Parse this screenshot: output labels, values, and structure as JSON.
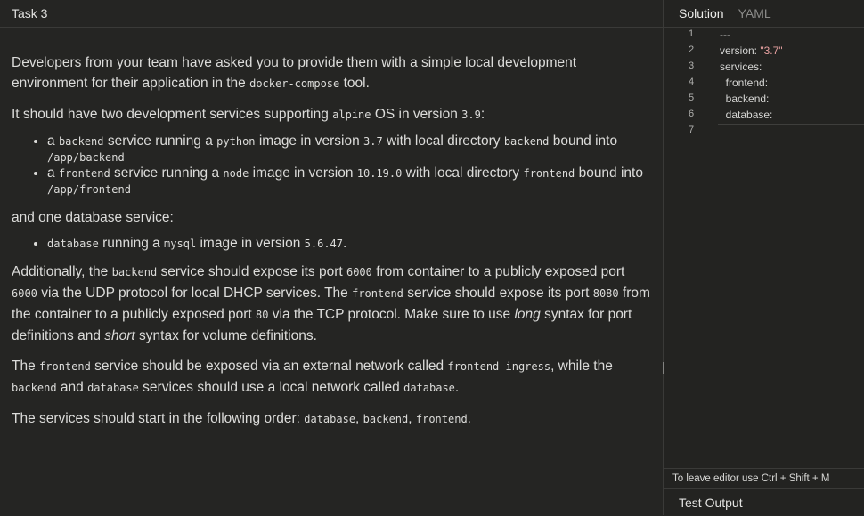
{
  "task": {
    "title": "Task 3",
    "p1_a": "Developers from your team have asked you to provide them with a simple local development environment for their application in the ",
    "p1_code": "docker-compose",
    "p1_b": " tool.",
    "p2_a": "It should have two development services supporting ",
    "p2_code1": "alpine",
    "p2_b": " OS in version ",
    "p2_code2": "3.9",
    "p2_c": ":",
    "bullet1": {
      "code1": "backend",
      "t1": " service running a ",
      "code2": "python",
      "t2": " image in version ",
      "code3": "3.7",
      "t3": " with local directory ",
      "code4": "backend",
      "t4": " bound into ",
      "code5": "/app/backend"
    },
    "bullet2": {
      "code1": "frontend",
      "t1": " service running a ",
      "code2": "node",
      "t2": " image in version ",
      "code3": "10.19.0",
      "t3": " with local directory ",
      "code4": "frontend",
      "t4": " bound into ",
      "code5": "/app/frontend"
    },
    "p3": "and one database service:",
    "bullet3": {
      "code1": "database",
      "t1": " running a ",
      "code2": "mysql",
      "t2": " image in version ",
      "code3": "5.6.47",
      "t3": "."
    },
    "p4": {
      "a": "Additionally, the ",
      "c1": "backend",
      "b": " service should expose its port ",
      "c2": "6000",
      "c": " from container to a publicly exposed port ",
      "c3": "6000",
      "d": " via the UDP protocol for local DHCP services. The ",
      "c4": "frontend",
      "e": " service should expose its port ",
      "c5": "8080",
      "f": " from the container to a publicly exposed port ",
      "c6": "80",
      "g": " via the TCP protocol. Make sure to use ",
      "em1": "long",
      "h": " syntax for port definitions and ",
      "em2": "short",
      "i": " syntax for volume definitions."
    },
    "p5": {
      "a": "The ",
      "c1": "frontend",
      "b": " service should be exposed via an external network called ",
      "c2": "frontend-ingress",
      "c": ", while the ",
      "c3": "backend",
      "d": " and ",
      "c4": "database",
      "e": " services should use a local network called ",
      "c5": "database",
      "f": "."
    },
    "p6": {
      "a": "The services should start in the following order: ",
      "c1": "database",
      "b": ", ",
      "c2": "backend",
      "c": ", ",
      "c3": "frontend",
      "d": "."
    }
  },
  "editor": {
    "tabs": [
      "Solution",
      "YAML"
    ],
    "lines": [
      {
        "n": "1",
        "code": "---"
      },
      {
        "n": "2",
        "key": "version: ",
        "str": "\"3.7\""
      },
      {
        "n": "3",
        "code": "services:"
      },
      {
        "n": "4",
        "code": "  frontend:"
      },
      {
        "n": "5",
        "code": "  backend:"
      },
      {
        "n": "6",
        "code": "  database:"
      },
      {
        "n": "7",
        "code": ""
      }
    ],
    "hint": "To leave editor use Ctrl + Shift + M",
    "test_output": "Test Output",
    "drag_handle_glyph": "||"
  }
}
